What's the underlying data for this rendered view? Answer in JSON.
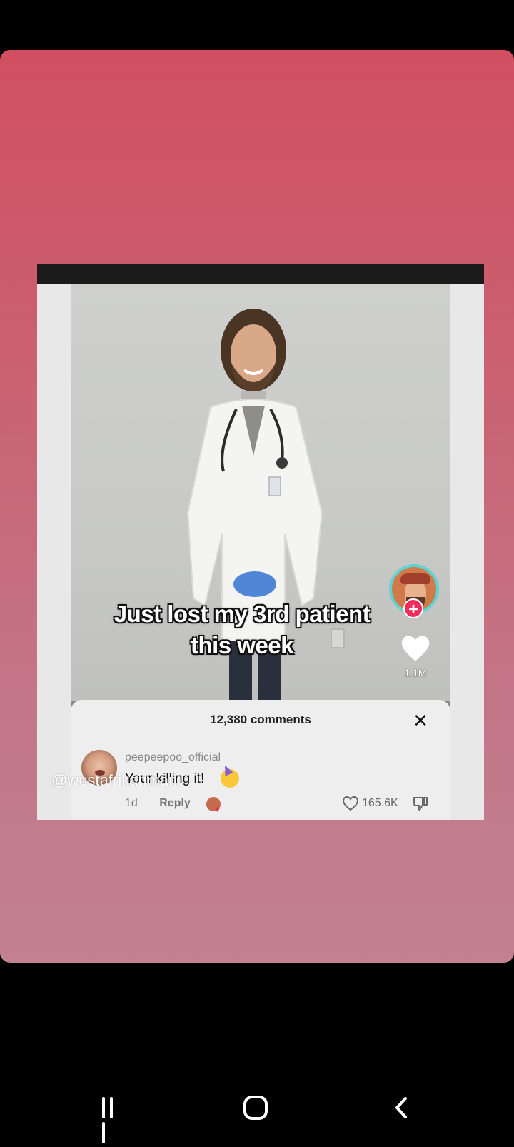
{
  "post": {
    "caption": "Just lost my 3rd patient this week",
    "likes": "1.1M",
    "watermark": "@westafrikanman"
  },
  "comments_sheet": {
    "title": "12,380 comments",
    "comment": {
      "username": "peepeepoo_official",
      "text": "Your killing it!",
      "time": "1d",
      "reply_label": "Reply",
      "like_count": "165.6K"
    }
  },
  "colors": {
    "accent_follow": "#f02c5b",
    "avatar_ring": "#5fd3cf",
    "gradient_top": "#d14f60",
    "gradient_bottom": "#c2818f"
  },
  "icons": {
    "close": "close-icon",
    "like": "heart-icon",
    "dislike": "thumbs-down-icon",
    "nav": [
      "recents-icon",
      "home-icon",
      "back-icon"
    ]
  }
}
